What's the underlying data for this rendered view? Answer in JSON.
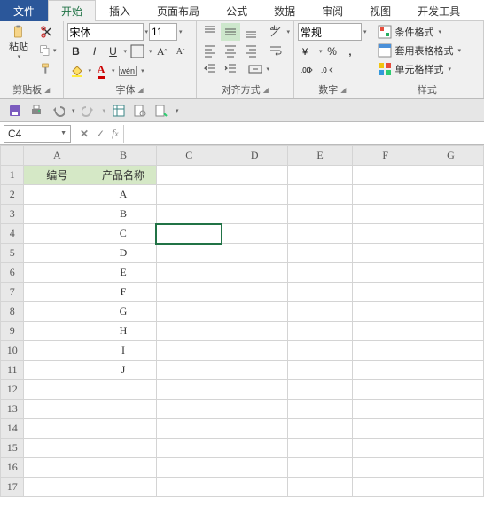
{
  "tabs": {
    "file": "文件",
    "home": "开始",
    "insert": "插入",
    "layout": "页面布局",
    "formula": "公式",
    "data": "数据",
    "review": "审阅",
    "view": "视图",
    "dev": "开发工具"
  },
  "groups": {
    "clipboard": "剪贴板",
    "font": "字体",
    "align": "对齐方式",
    "number": "数字",
    "styles": "样式"
  },
  "clipboard": {
    "paste": "粘贴"
  },
  "font": {
    "name": "宋体",
    "size": "11",
    "bold": "B",
    "italic": "I",
    "underline": "U"
  },
  "align": {},
  "number": {
    "format": "常规",
    "percent": "%"
  },
  "styles": {
    "cond": "条件格式",
    "table": "套用表格格式",
    "cell": "单元格样式"
  },
  "namebox": "C4",
  "headers": {
    "a": "编号",
    "b": "产品名称"
  },
  "rows": [
    {
      "b": "A"
    },
    {
      "b": "B"
    },
    {
      "b": "C"
    },
    {
      "b": "D"
    },
    {
      "b": "E"
    },
    {
      "b": "F"
    },
    {
      "b": "G"
    },
    {
      "b": "H"
    },
    {
      "b": "I"
    },
    {
      "b": "J"
    }
  ],
  "cols": [
    "A",
    "B",
    "C",
    "D",
    "E",
    "F",
    "G"
  ],
  "rownums": [
    1,
    2,
    3,
    4,
    5,
    6,
    7,
    8,
    9,
    10,
    11,
    12,
    13,
    14,
    15,
    16,
    17
  ]
}
